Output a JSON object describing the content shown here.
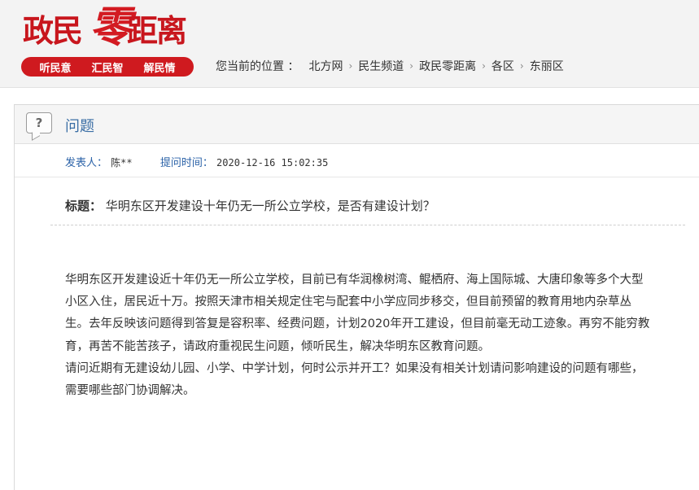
{
  "header": {
    "logo": {
      "part1": "政民",
      "part2": "零",
      "part3": "距离"
    },
    "slogans": [
      "听民意",
      "汇民智",
      "解民情"
    ],
    "breadcrumb_label": "您当前的位置 ：",
    "breadcrumbs": [
      "北方网",
      "民生频道",
      "政民零距离",
      "各区",
      "东丽区"
    ],
    "breadcrumb_sep": "›"
  },
  "panel": {
    "title": "问题",
    "icon_glyph": "?",
    "author_label": "发表人：",
    "author": "陈**",
    "time_label": "提问时间：",
    "time": "2020-12-16 15:02:35",
    "subject_label": "标题：",
    "subject": "华明东区开发建设十年仍无一所公立学校，是否有建设计划？",
    "paragraphs": [
      "华明东区开发建设近十年仍无一所公立学校，目前已有华润橡树湾、鲲栖府、海上国际城、大唐印象等多个大型小区入住，居民近十万。按照天津市相关规定住宅与配套中小学应同步移交，但目前预留的教育用地内杂草丛生。去年反映该问题得到答复是容积率、经费问题，计划2020年开工建设，但目前毫无动工迹象。再穷不能穷教育，再苦不能苦孩子，请政府重视民生问题，倾听民生，解决华明东区教育问题。",
      "请问近期有无建设幼儿园、小学、中学计划，何时公示并开工？如果没有相关计划请问影响建设的问题有哪些，需要哪些部门协调解决。"
    ]
  },
  "colors": {
    "brand_red": "#cf1a1f",
    "link_blue": "#2c63a8"
  }
}
